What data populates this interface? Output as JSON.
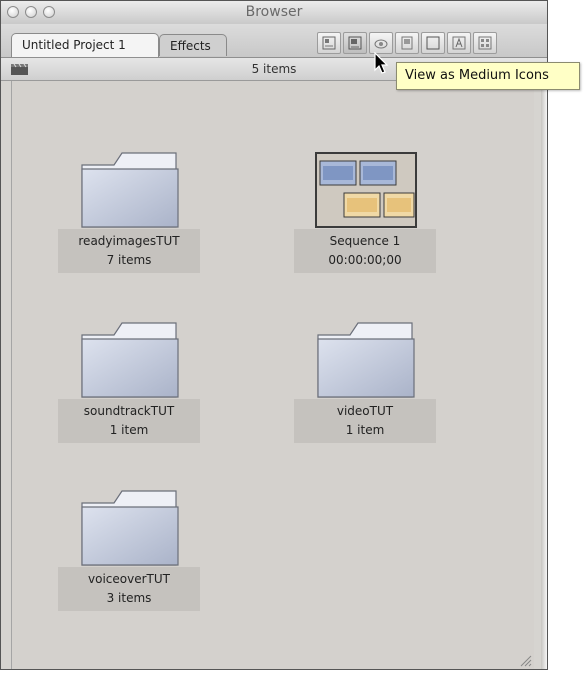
{
  "window": {
    "title": "Browser"
  },
  "tabs": [
    {
      "label": "Untitled Project 1",
      "active": true
    },
    {
      "label": "Effects",
      "active": false
    }
  ],
  "view_buttons": [
    {
      "name": "view-as-small-icons-icon"
    },
    {
      "name": "view-as-medium-icons-icon"
    },
    {
      "name": "view-as-large-icons-icon"
    },
    {
      "name": "view-as-list-icon"
    },
    {
      "name": "view-as-large-list-icon"
    },
    {
      "name": "view-as-extra-large-icon"
    },
    {
      "name": "view-options-icon"
    }
  ],
  "status": {
    "count_text": "5 items"
  },
  "tooltip": {
    "text": "View as Medium Icons"
  },
  "items": [
    {
      "type": "folder",
      "name": "readyimagesTUT",
      "detail": "7 items"
    },
    {
      "type": "sequence",
      "name": "Sequence 1",
      "detail": "00:00:00;00"
    },
    {
      "type": "folder",
      "name": "soundtrackTUT",
      "detail": "1 item"
    },
    {
      "type": "folder",
      "name": "videoTUT",
      "detail": "1 item"
    },
    {
      "type": "folder",
      "name": "voiceoverTUT",
      "detail": "3 items"
    }
  ],
  "colors": {
    "folder_fill": "#c9cfdf",
    "label_bg": "#c5c2be",
    "tooltip_bg": "#ffffc6",
    "content_bg": "#d4d1cd"
  }
}
